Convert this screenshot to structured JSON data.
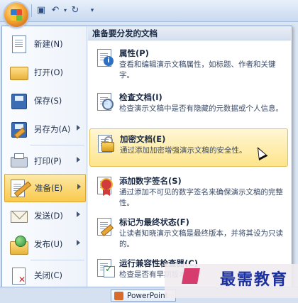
{
  "left_menu": [
    {
      "label": "新建(N)",
      "icon": "new-document-icon"
    },
    {
      "label": "打开(O)",
      "icon": "open-folder-icon"
    },
    {
      "label": "保存(S)",
      "icon": "save-disk-icon"
    },
    {
      "label": "另存为(A)",
      "icon": "save-as-icon"
    },
    {
      "label": "打印(P)",
      "icon": "printer-icon"
    },
    {
      "label": "准备(E)",
      "icon": "prepare-pencil-icon"
    },
    {
      "label": "发送(D)",
      "icon": "send-envelope-icon"
    },
    {
      "label": "发布(U)",
      "icon": "publish-globe-icon"
    },
    {
      "label": "关闭(C)",
      "icon": "close-document-icon"
    }
  ],
  "submenu": {
    "header": "准备要分发的文档",
    "items": [
      {
        "title": "属性(P)",
        "desc": "查看和编辑演示文稿属性，如标题、作者和关键字。",
        "icon": "properties-info-icon"
      },
      {
        "title": "检查文档(I)",
        "desc": "检查演示文稿中是否有隐藏的元数据或个人信息。",
        "icon": "inspect-magnifier-icon"
      },
      {
        "title": "加密文档(E)",
        "desc": "通过添加加密增强演示文稿的安全性。",
        "icon": "encrypt-lock-icon"
      },
      {
        "title": "添加数字签名(S)",
        "desc": "通过添加不可见的数字签名来确保演示文稿的完整性。",
        "icon": "signature-ribbon-icon"
      },
      {
        "title": "标记为最终状态(F)",
        "desc": "让读者知晓演示文稿是最终版本，并将其设为只读的。",
        "icon": "mark-final-icon"
      },
      {
        "title": "运行兼容性检查器(C)",
        "desc": "检查是否有早期版本",
        "icon": "compatibility-check-icon"
      }
    ]
  },
  "taskbar": {
    "label": "PowerPoint"
  },
  "watermark": {
    "text": "最需教育"
  }
}
